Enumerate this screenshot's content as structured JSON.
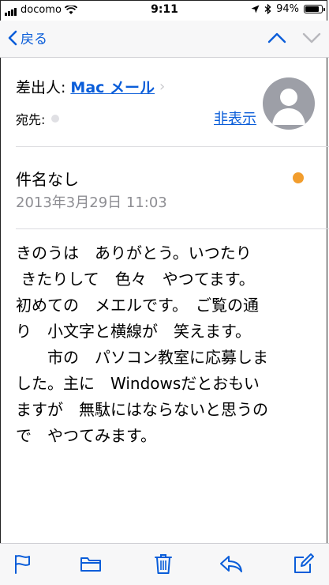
{
  "status_bar": {
    "carrier": "docomo",
    "time": "9:11",
    "battery": "94%",
    "battery_level": 0.94
  },
  "nav": {
    "back_label": "戻る"
  },
  "header": {
    "from_label": "差出人:",
    "from_name": "Mac メール",
    "to_label": "宛先:",
    "hide_link": "非表示"
  },
  "message": {
    "subject": "件名なし",
    "date": "2013年3月29日 11:03",
    "body": "きのうは　ありがとう。いつたり\n きたりして　色々　やつてます。\n初めての　メエルです。　ご覧の通\nり　小文字と横線が　笑えます。\n　　市の　パソコン教室に応募しま\nした。主に　Windowsだとおもい\nますが　無駄にはならないと思うの\nで　やつてみます。"
  },
  "colors": {
    "link_blue": "#0a5dd9",
    "unread_dot": "#f29d2d",
    "date_gray": "#8e8e93"
  },
  "toolbar": {
    "icons": [
      "flag-icon",
      "folder-icon",
      "trash-icon",
      "reply-icon",
      "compose-icon"
    ]
  }
}
